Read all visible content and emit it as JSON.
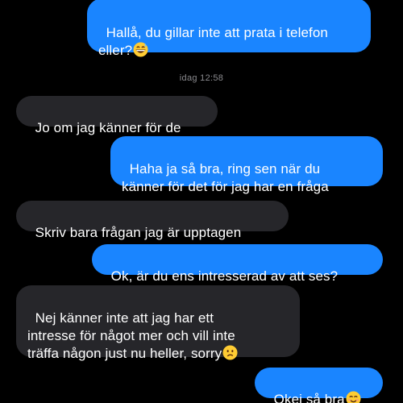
{
  "conversation": {
    "timestamp": "idag 12:58",
    "messages": [
      {
        "sender": "me",
        "text": "Hallå, du gillar inte att prata i telefon\neller?",
        "emoji": "grinning-sweat-emoji"
      },
      {
        "sender": "them",
        "text": "Jo om jag känner för de"
      },
      {
        "sender": "me",
        "text": "Haha ja så bra, ring sen när du\nkänner för det för jag har en fråga"
      },
      {
        "sender": "them",
        "text": "Skriv bara frågan jag är upptagen"
      },
      {
        "sender": "me",
        "text": "Ok, är du ens intresserad av att ses?"
      },
      {
        "sender": "them",
        "text": "Nej känner inte att jag har ett\nintresse för något mer och vill inte\nträffa någon just nu heller, sorry",
        "emoji": "confused-face-emoji"
      },
      {
        "sender": "me",
        "text": "Okej så bra",
        "emoji": "smiling-blush-emoji"
      }
    ]
  },
  "colors": {
    "background": "#000000",
    "sent_bubble": "#1a85ff",
    "received_bubble": "#26262a",
    "timestamp_text": "#8a8a8e"
  }
}
